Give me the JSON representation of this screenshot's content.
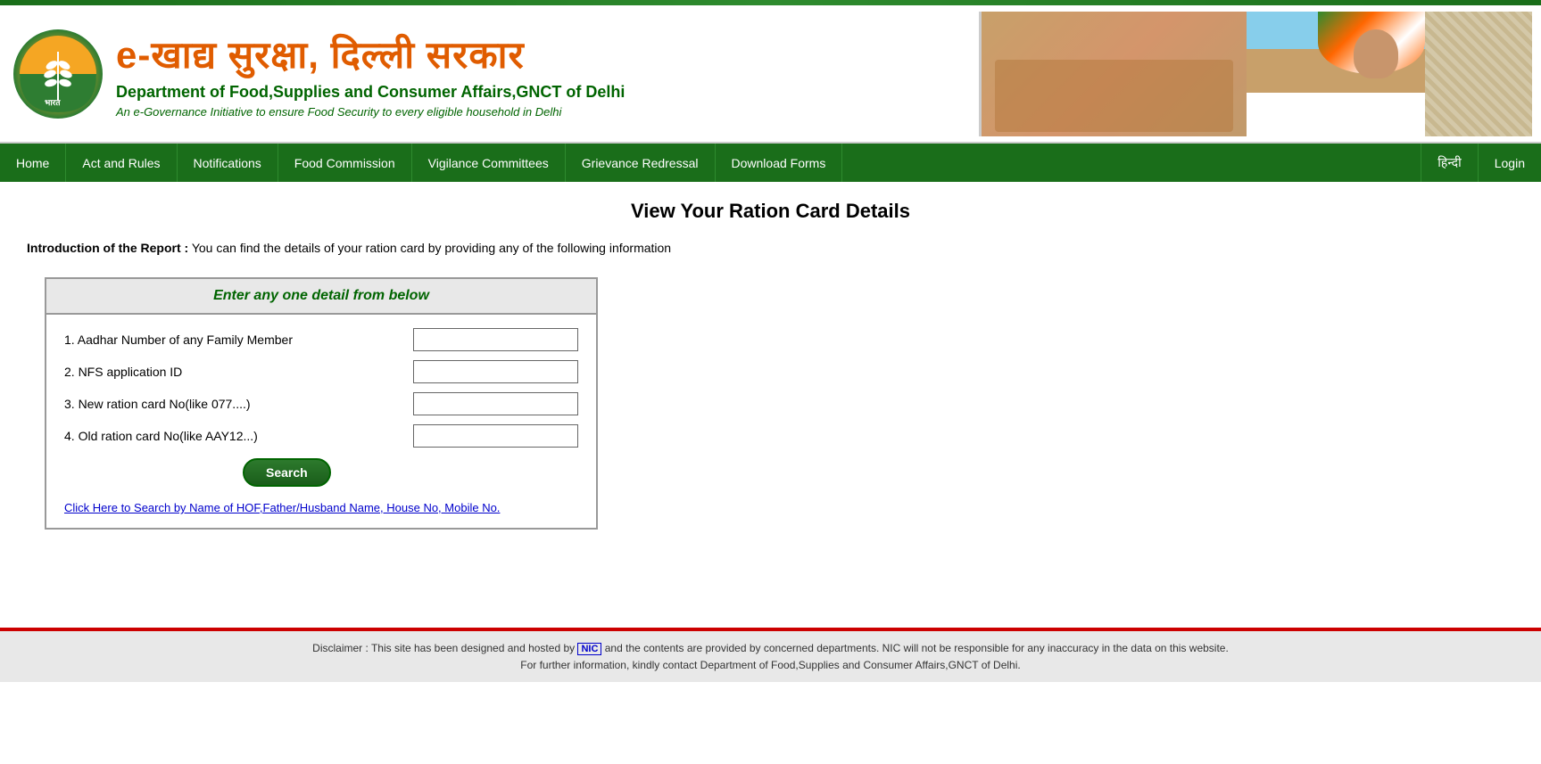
{
  "topBorder": {},
  "header": {
    "title_hi": "e-खाद्य सुरक्षा, दिल्ली सरकार",
    "dept": "Department of Food,Supplies and Consumer Affairs,GNCT of Delhi",
    "sub": "An e-Governance Initiative to ensure Food Security to every eligible household in Delhi"
  },
  "nav": {
    "items": [
      {
        "label": "Home",
        "id": "home"
      },
      {
        "label": "Act and Rules",
        "id": "act-rules"
      },
      {
        "label": "Notifications",
        "id": "notifications"
      },
      {
        "label": "Food Commission",
        "id": "food-commission"
      },
      {
        "label": "Vigilance Committees",
        "id": "vigilance"
      },
      {
        "label": "Grievance Redressal",
        "id": "grievance"
      },
      {
        "label": "Download Forms",
        "id": "download-forms"
      }
    ],
    "right_items": [
      {
        "label": "हिन्दी",
        "id": "hindi"
      },
      {
        "label": "Login",
        "id": "login"
      }
    ]
  },
  "main": {
    "page_title": "View Your Ration Card Details",
    "intro_label": "Introduction of the Report :",
    "intro_text": " You can find the details of your ration card by providing any of the following information",
    "form": {
      "header": "Enter any one detail from below",
      "fields": [
        {
          "label": "1. Aadhar Number of any Family Member",
          "id": "aadhar",
          "value": ""
        },
        {
          "label": "2. NFS application ID",
          "id": "nfs",
          "value": ""
        },
        {
          "label": "3. New ration card No(like 077....)",
          "id": "new-rc",
          "value": ""
        },
        {
          "label": "4. Old ration card No(like AAY12...)",
          "id": "old-rc",
          "value": ""
        }
      ],
      "search_btn": "Search",
      "alt_search_link": "Click Here to Search by Name of HOF,Father/Husband Name, House No, Mobile No."
    }
  },
  "footer": {
    "disclaimer": "Disclaimer : This site has been designed and hosted by ",
    "nic": "NIC",
    "disclaimer2": " and the contents are provided by concerned departments. NIC will not be responsible for any inaccuracy in the data on this website.",
    "contact": "For further information, kindly contact Department of Food,Supplies and Consumer Affairs,GNCT of Delhi."
  }
}
